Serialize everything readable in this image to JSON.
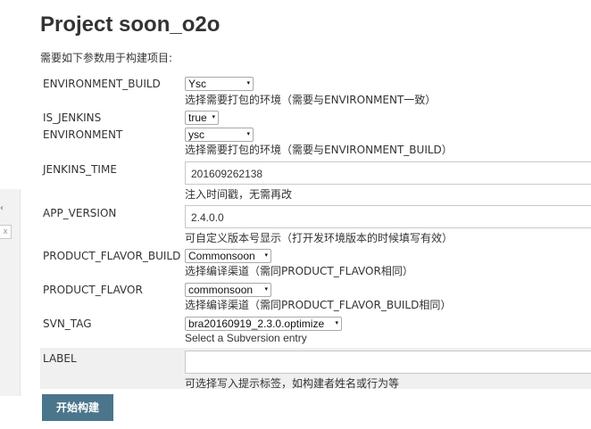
{
  "title": "Project soon_o2o",
  "intro": "需要如下参数用于构建项目:",
  "params": [
    {
      "name": "ENVIRONMENT_BUILD",
      "value": "Ysc",
      "description": "选择需要打包的环境（需要与ENVIRONMENT一致）"
    },
    {
      "name": "IS_JENKINS",
      "value": "true",
      "description": ""
    },
    {
      "name": "ENVIRONMENT",
      "value": "ysc",
      "description": "选择需要打包的环境（需要与ENVIRONMENT_BUILD）"
    },
    {
      "name": "JENKINS_TIME",
      "value": "201609262138",
      "description": "注入时间戳，无需再改"
    },
    {
      "name": "APP_VERSION",
      "value": "2.4.0.0",
      "description": "可自定义版本号显示（打开发环境版本的时候填写有效）"
    },
    {
      "name": "PRODUCT_FLAVOR_BUILD",
      "value": "Commonsoon",
      "description": "选择编译渠道（需同PRODUCT_FLAVOR相同）"
    },
    {
      "name": "PRODUCT_FLAVOR",
      "value": "commonsoon",
      "description": "选择编译渠道（需同PRODUCT_FLAVOR_BUILD相同）"
    },
    {
      "name": "SVN_TAG",
      "value": "bra20160919_2.3.0.optimize",
      "description": "Select a Subversion entry"
    },
    {
      "name": "LABEL",
      "value": "",
      "description": "可选择写入提示标签，如构建者姓名或行为等"
    }
  ],
  "submit_label": "开始构建",
  "icons": {
    "select_arrow": "▾",
    "left_chevron": "‹",
    "close": "x"
  }
}
